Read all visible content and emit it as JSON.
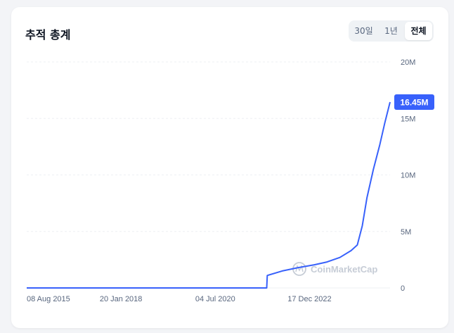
{
  "header": {
    "title": "추적 총계",
    "tabs": [
      {
        "label": "30일",
        "active": false
      },
      {
        "label": "1년",
        "active": false
      },
      {
        "label": "전체",
        "active": true
      }
    ]
  },
  "watermark": "CoinMarketCap",
  "colors": {
    "line": "#3861fb",
    "badge": "#3861fb",
    "grid": "#eef0f3",
    "text": "#58667e"
  },
  "chart_data": {
    "type": "line",
    "title": "추적 총계",
    "y_ticks": [
      "20M",
      "15M",
      "10M",
      "5M",
      "0"
    ],
    "y_tick_values": [
      20000000,
      15000000,
      10000000,
      5000000,
      0
    ],
    "x_ticks": [
      "08 Aug 2015",
      "20 Jan 2018",
      "04 Jul 2020",
      "17 Dec 2022"
    ],
    "ylim": [
      0,
      20000000
    ],
    "grid": true,
    "current_value_label": "16.45M",
    "series": [
      {
        "x": [
          "2015-08-08",
          "2016-06-01",
          "2017-06-01",
          "2018-06-01",
          "2019-06-01",
          "2020-06-01",
          "2021-06-01",
          "2021-11-05",
          "2021-11-10",
          "2022-04-01",
          "2022-09-01",
          "2023-02-01",
          "2023-06-01",
          "2023-10-01",
          "2024-01-15",
          "2024-03-15",
          "2024-05-01",
          "2024-06-15",
          "2024-08-15",
          "2024-10-15",
          "2024-12-01",
          "2025-01-20"
        ],
        "y": [
          0,
          0,
          0,
          0,
          0,
          0,
          0,
          0,
          1100000,
          1500000,
          1800000,
          2050000,
          2300000,
          2700000,
          3300000,
          3800000,
          5500000,
          8000000,
          10500000,
          12700000,
          14600000,
          16450000
        ]
      }
    ]
  }
}
